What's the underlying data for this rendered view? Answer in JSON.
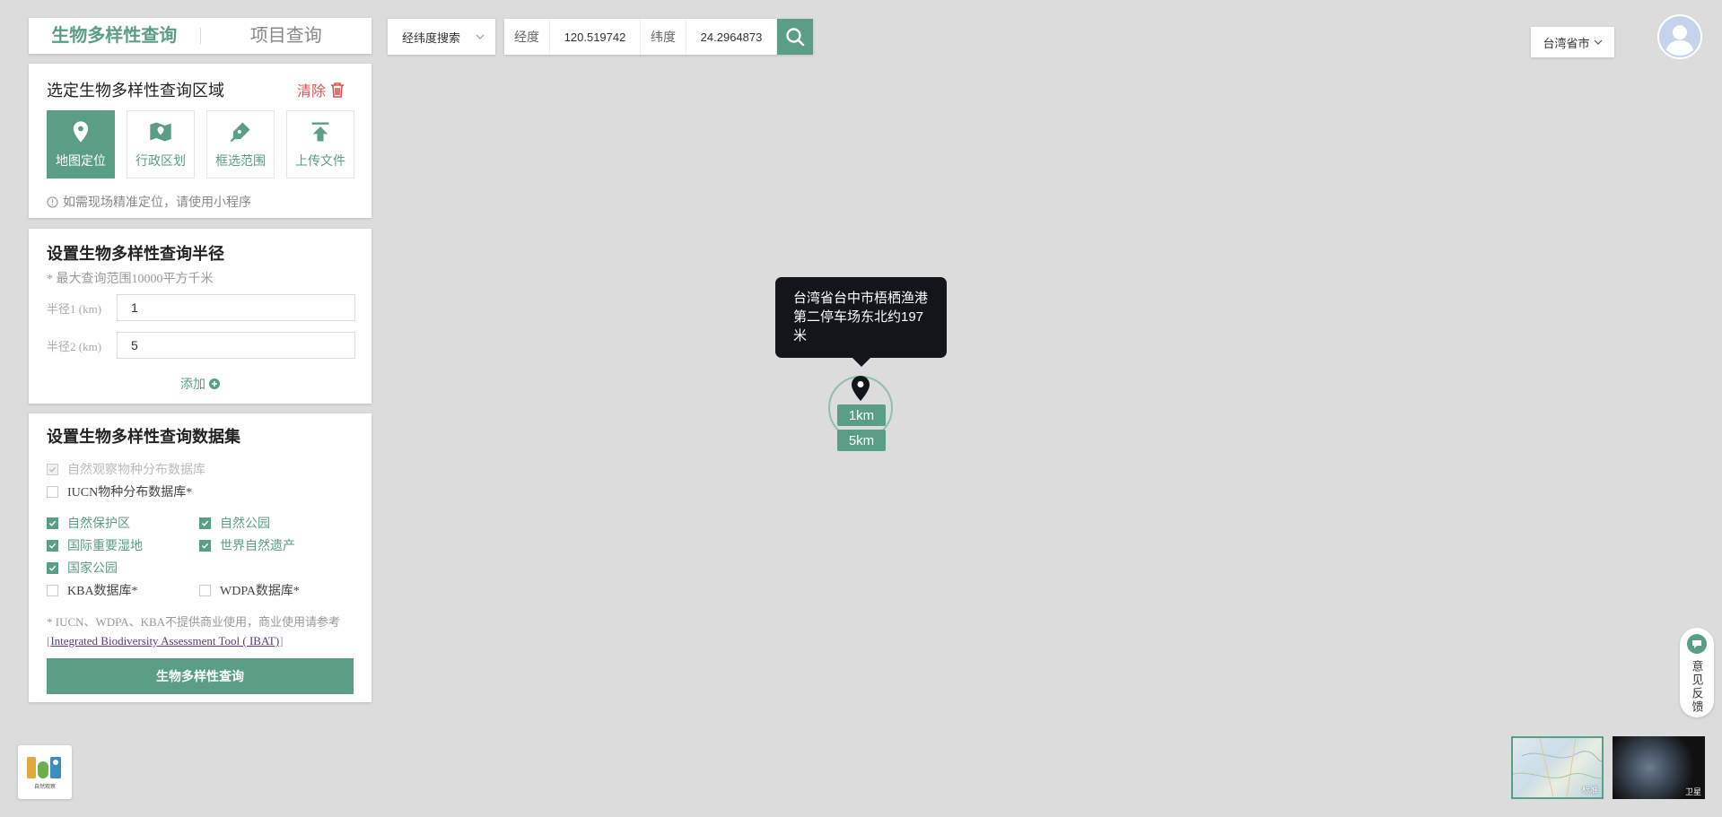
{
  "tabs": {
    "biodiversity": "生物多样性查询",
    "project": "项目查询"
  },
  "area_panel": {
    "title": "选定生物多样性查询区域",
    "clear_label": "清除",
    "methods": [
      {
        "label": "地图定位",
        "icon": "map-pin-icon",
        "active": true
      },
      {
        "label": "行政区划",
        "icon": "map-region-icon",
        "active": false
      },
      {
        "label": "框选范围",
        "icon": "pen-icon",
        "active": false
      },
      {
        "label": "上传文件",
        "icon": "upload-icon",
        "active": false
      }
    ],
    "hint": "如需现场精准定位，请使用小程序"
  },
  "radius_panel": {
    "title": "设置生物多样性查询半径",
    "note": "* 最大查询范围10000平方千米",
    "radii": [
      {
        "label": "半径1 (km)",
        "value": "1"
      },
      {
        "label": "半径2 (km)",
        "value": "5"
      }
    ],
    "add_label": "添加"
  },
  "dataset_panel": {
    "title": "设置生物多样性查询数据集",
    "datasets": {
      "nature_obs": "自然观察物种分布数据库",
      "iucn": "IUCN物种分布数据库*",
      "reserve": "自然保护区",
      "park": "自然公园",
      "wetland": "国际重要湿地",
      "heritage": "世界自然遗产",
      "national_park": "国家公园",
      "kba": "KBA数据库*",
      "wdpa": "WDPA数据库*"
    },
    "footnote_prefix": "* IUCN、WDPA、KBA不提供商业使用，商业使用请参考[",
    "footnote_link": "Integrated Biodiversity Assessment Tool ( IBAT)",
    "footnote_suffix": "]",
    "query_button": "生物多样性查询"
  },
  "search": {
    "mode": "经纬度搜索",
    "lng_label": "经度",
    "lng_value": "120.519742",
    "lat_label": "纬度",
    "lat_value": "24.2964873"
  },
  "region_select": "台湾省市",
  "map": {
    "tooltip": "台湾省台中市梧栖渔港第二停车场东北约197米",
    "radius_badges": [
      "1km",
      "5km"
    ]
  },
  "feedback_label": "意见反馈",
  "logo_text": "自然观察",
  "map_types": {
    "standard": "标准",
    "satellite": "卫星"
  },
  "colors": {
    "accent": "#5a9e86",
    "danger": "#d9534f",
    "tooltip_bg": "#12151a"
  }
}
